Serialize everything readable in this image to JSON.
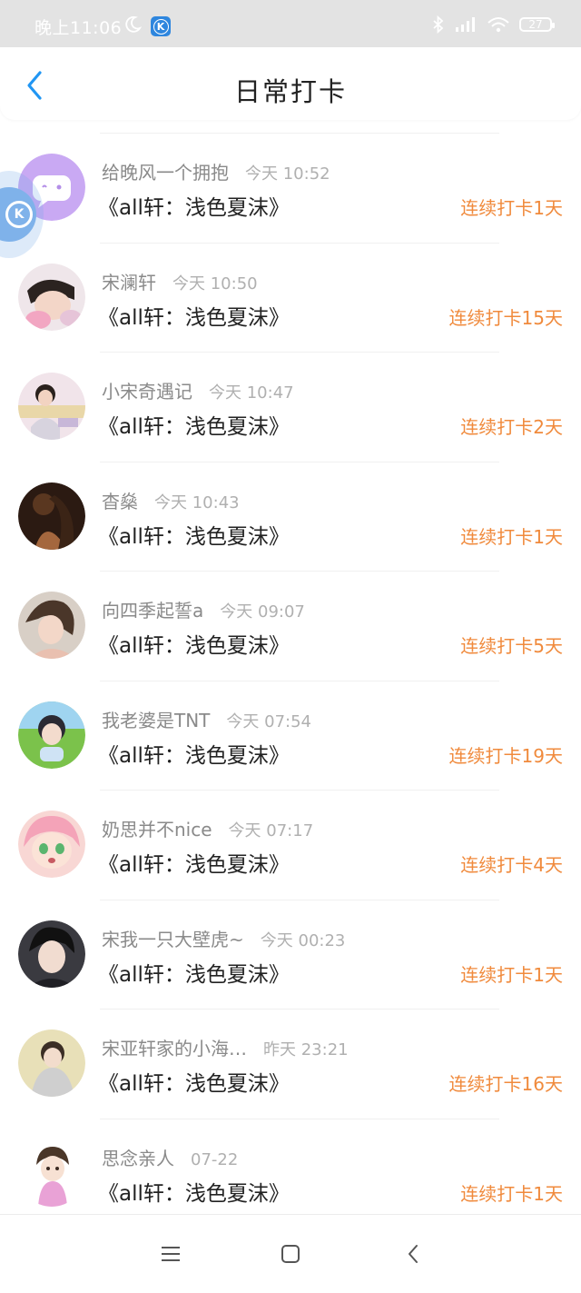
{
  "status_bar": {
    "time": "晚上11:06",
    "battery": "27",
    "icons": [
      "moon-icon",
      "k-app-icon",
      "bluetooth-icon",
      "signal-icon",
      "wifi-icon",
      "battery-icon"
    ]
  },
  "header": {
    "title": "日常打卡",
    "back_icon": "chevron-left-icon"
  },
  "colors": {
    "accent_orange": "#f08a3c",
    "back_blue": "#2196f3",
    "name_gray": "#8a8a8a",
    "time_gray": "#b0b0b0"
  },
  "items": [
    {
      "name": "给晚风一个拥抱",
      "time": "今天 10:52",
      "title": "《all轩：浅色夏沫》",
      "streak": "连续打卡1天"
    },
    {
      "name": "宋澜轩",
      "time": "今天 10:50",
      "title": "《all轩：浅色夏沫》",
      "streak": "连续打卡15天"
    },
    {
      "name": "小宋奇遇记",
      "time": "今天 10:47",
      "title": "《all轩：浅色夏沫》",
      "streak": "连续打卡2天"
    },
    {
      "name": "杳燊",
      "time": "今天 10:43",
      "title": "《all轩：浅色夏沫》",
      "streak": "连续打卡1天"
    },
    {
      "name": "向四季起誓a",
      "time": "今天 09:07",
      "title": "《all轩：浅色夏沫》",
      "streak": "连续打卡5天"
    },
    {
      "name": "我老婆是TNT",
      "time": "今天 07:54",
      "title": "《all轩：浅色夏沫》",
      "streak": "连续打卡19天"
    },
    {
      "name": "奶思并不nice",
      "time": "今天 07:17",
      "title": "《all轩：浅色夏沫》",
      "streak": "连续打卡4天"
    },
    {
      "name": "宋我一只大壁虎~",
      "time": "今天 00:23",
      "title": "《all轩：浅色夏沫》",
      "streak": "连续打卡1天"
    },
    {
      "name": "宋亚轩家的小海…",
      "time": "昨天 23:21",
      "title": "《all轩：浅色夏沫》",
      "streak": "连续打卡16天"
    },
    {
      "name": "思念亲人",
      "time": "07-22",
      "title": "《all轩：浅色夏沫》",
      "streak": "连续打卡1天"
    }
  ],
  "nav_bar": {
    "icons": [
      "menu-icon",
      "home-square-icon",
      "back-triangle-icon"
    ]
  }
}
